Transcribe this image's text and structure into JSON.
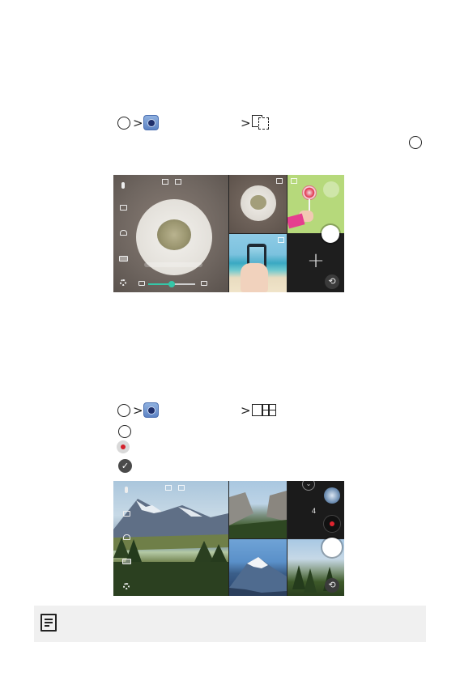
{
  "section1": {
    "gt1": ">",
    "gt2": ">",
    "mode_icon": "dual-screen-icon"
  },
  "section2": {
    "gt1": ">",
    "gt2": ">",
    "mode_icon": "grid-icon",
    "step_count": "4",
    "check_icon": "checkmark-icon",
    "record_icon": "record-icon"
  },
  "screenshot1": {
    "left_panel_color": "#6e6560",
    "zoom_level": 0.5,
    "back_glyph": "⟲",
    "add_glyph": "+"
  },
  "screenshot2": {
    "back_glyph": "⟲",
    "count": "4"
  },
  "note": {
    "icon": "note-icon"
  }
}
